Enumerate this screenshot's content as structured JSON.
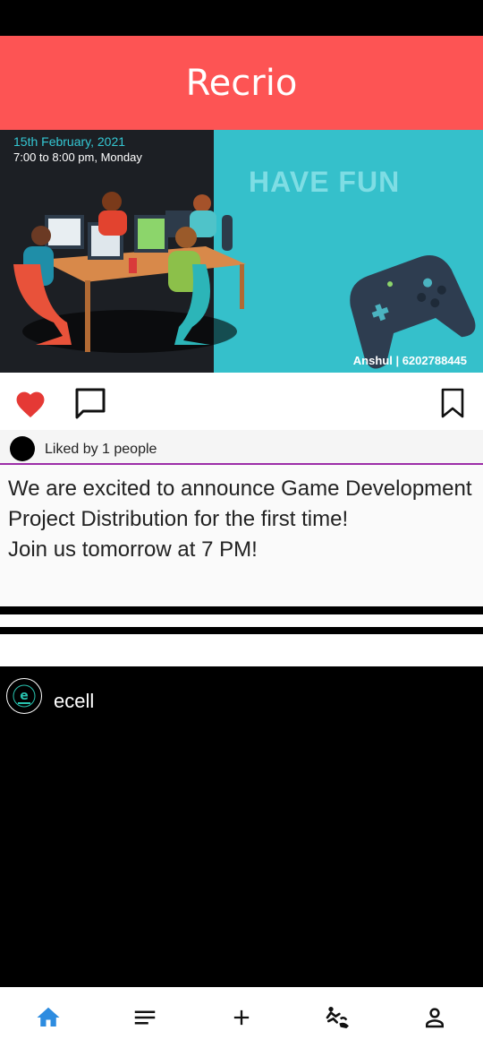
{
  "app": {
    "title": "Recrio"
  },
  "post1": {
    "banner": {
      "date": "15th February, 2021",
      "time": "7:00 to 8:00 pm, Monday",
      "headline": "HAVE FUN",
      "credit": "Anshul  | 6202788445"
    },
    "actions": {
      "like_icon": "heart-icon",
      "comment_icon": "comment-icon",
      "save_icon": "bookmark-icon",
      "liked": true
    },
    "likes_text": "Liked by 1 people",
    "caption_lines": [
      "We are excited to announce Game Development",
      "Project Distribution for the first time!",
      "Join us tomorrow at 7 PM!"
    ]
  },
  "post2": {
    "username": "ecell"
  },
  "bottom_nav": [
    {
      "icon": "home-icon",
      "active": true
    },
    {
      "icon": "feed-icon",
      "active": false
    },
    {
      "icon": "add-icon",
      "active": false
    },
    {
      "icon": "connections-icon",
      "active": false
    },
    {
      "icon": "profile-icon",
      "active": false
    }
  ],
  "colors": {
    "header": "#fd5454",
    "accent": "#2d8ce0",
    "like": "#e53935",
    "divider": "#9c2ea8"
  }
}
